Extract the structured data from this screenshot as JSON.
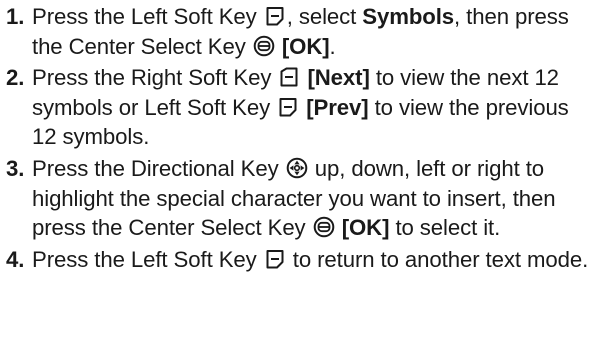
{
  "steps": [
    {
      "number": "1.",
      "parts": [
        {
          "t": "text",
          "v": "Press the Left Soft Key "
        },
        {
          "t": "icon",
          "v": "left-soft-key-icon"
        },
        {
          "t": "text",
          "v": ", select "
        },
        {
          "t": "bold",
          "v": "Symbols"
        },
        {
          "t": "text",
          "v": ", then press the Center Select Key "
        },
        {
          "t": "icon",
          "v": "center-select-key-icon"
        },
        {
          "t": "text",
          "v": " "
        },
        {
          "t": "bold",
          "v": "[OK]"
        },
        {
          "t": "text",
          "v": "."
        }
      ]
    },
    {
      "number": "2.",
      "parts": [
        {
          "t": "text",
          "v": "Press the Right Soft Key "
        },
        {
          "t": "icon",
          "v": "right-soft-key-icon"
        },
        {
          "t": "text",
          "v": " "
        },
        {
          "t": "bold",
          "v": "[Next]"
        },
        {
          "t": "text",
          "v": " to view the next 12 symbols or Left Soft Key "
        },
        {
          "t": "icon",
          "v": "left-soft-key-icon"
        },
        {
          "t": "text",
          "v": " "
        },
        {
          "t": "bold",
          "v": "[Prev]"
        },
        {
          "t": "text",
          "v": " to view the previous 12 symbols."
        }
      ]
    },
    {
      "number": "3.",
      "parts": [
        {
          "t": "text",
          "v": "Press the Directional Key "
        },
        {
          "t": "icon",
          "v": "directional-key-icon"
        },
        {
          "t": "text",
          "v": " up, down, left or right to highlight the special character you want to insert, then press the Center Select Key "
        },
        {
          "t": "icon",
          "v": "center-select-key-icon"
        },
        {
          "t": "text",
          "v": " "
        },
        {
          "t": "bold",
          "v": "[OK]"
        },
        {
          "t": "text",
          "v": " to select it."
        }
      ]
    },
    {
      "number": "4.",
      "parts": [
        {
          "t": "text",
          "v": "Press the Left Soft Key "
        },
        {
          "t": "icon",
          "v": "left-soft-key-icon"
        },
        {
          "t": "text",
          "v": " to return to another text mode."
        }
      ]
    }
  ],
  "colors": {
    "text": "#1a1a1a",
    "icon_stroke": "#1a1a1a",
    "background": "#ffffff"
  }
}
